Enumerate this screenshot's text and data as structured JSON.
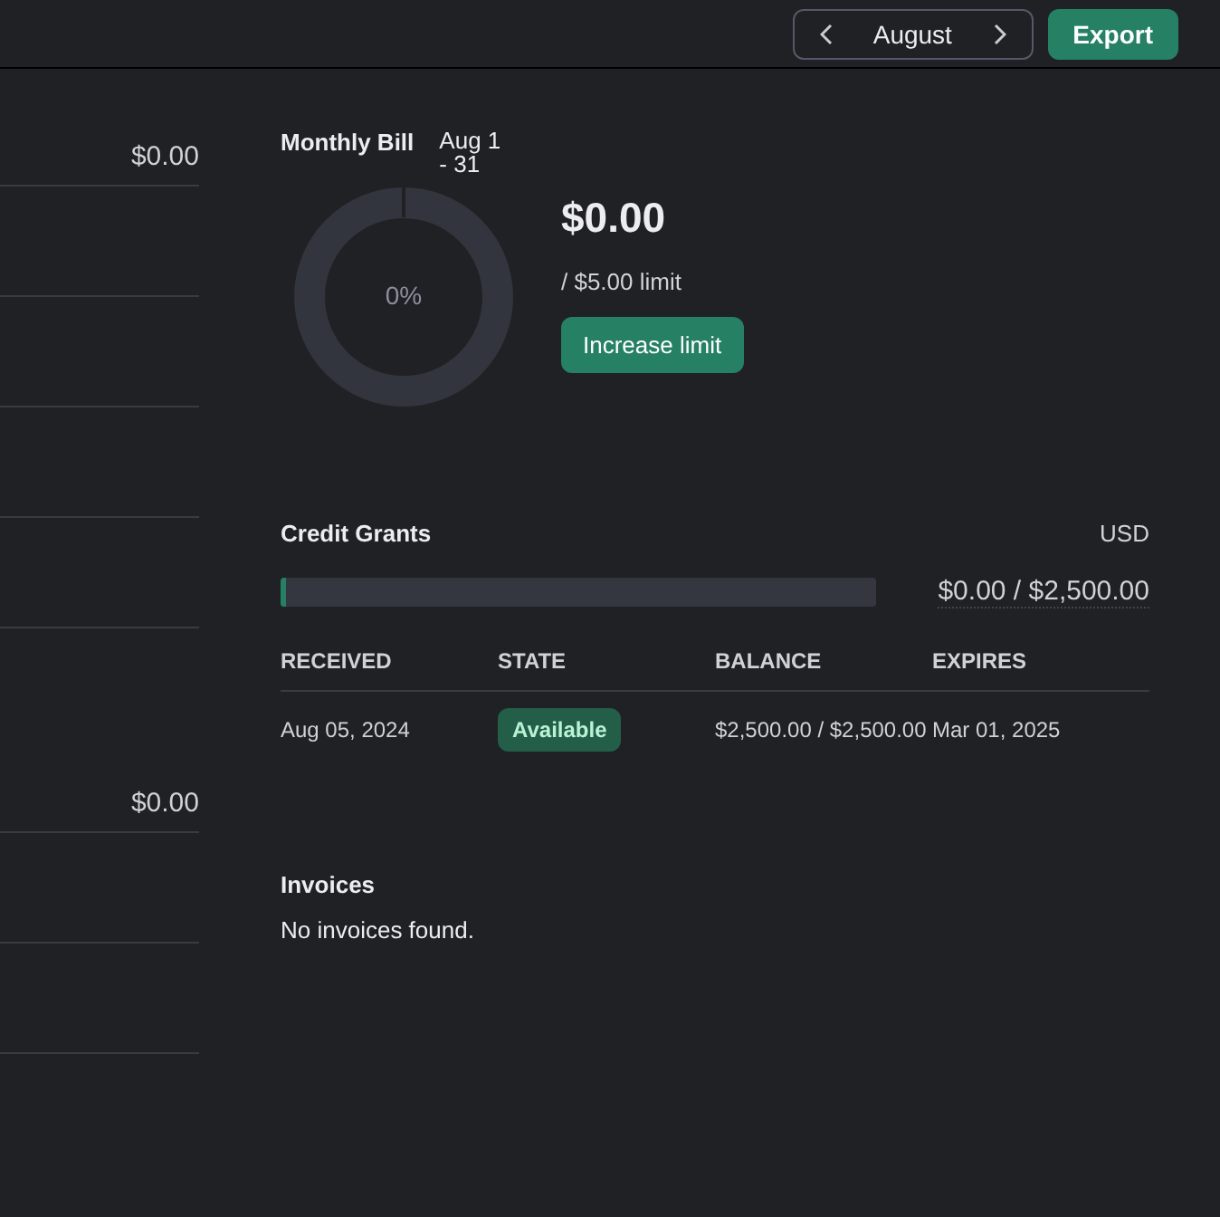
{
  "header": {
    "month_picker": {
      "label": "August"
    },
    "export_button": "Export"
  },
  "left_column": {
    "groups": [
      {
        "amount": "$0.00"
      },
      {
        "amount": "$0.00"
      }
    ]
  },
  "monthly_bill": {
    "title": "Monthly Bill",
    "period": "Aug 1 - 31",
    "usage": {
      "level": 0,
      "label": "0%"
    },
    "amount": "$0.00",
    "limit": "/ $5.00 limit",
    "button": "Increase limit"
  },
  "credit_grants": {
    "title": "Credit Grants",
    "currency": "USD",
    "bar": {
      "level": 0
    },
    "total": "$0.00 / $2,500.00",
    "table": {
      "columns": [
        "RECEIVED",
        "STATE",
        "BALANCE",
        "EXPIRES"
      ],
      "rows": [
        {
          "received": "Aug 05, 2024",
          "state": "Available",
          "balance": "$2,500.00 / $2,500.00",
          "expires": "Mar 01, 2025"
        }
      ]
    }
  },
  "invoices": {
    "title": "Invoices",
    "empty": "No invoices found."
  }
}
